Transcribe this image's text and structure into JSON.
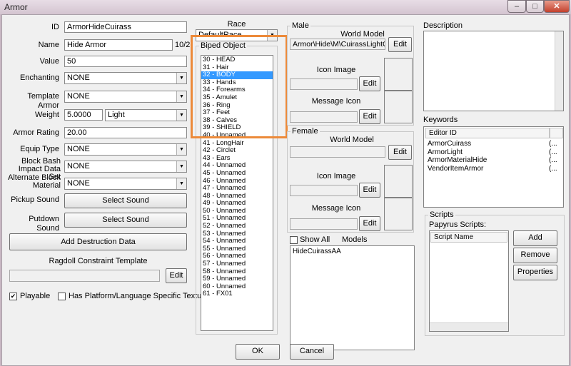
{
  "window": {
    "title": "Armor",
    "minimize": "–",
    "maximize": "□",
    "close": "✕"
  },
  "left": {
    "id_label": "ID",
    "id_value": "ArmorHideCuirass",
    "name_label": "Name",
    "name_value": "Hide Armor",
    "name_counter": "10/2",
    "value_label": "Value",
    "value_value": "50",
    "enchanting_label": "Enchanting",
    "enchanting_value": "NONE",
    "template_label": "Template Armor",
    "template_value": "NONE",
    "weight_label": "Weight",
    "weight_value": "5.0000",
    "weight_class": "Light",
    "armor_rating_label": "Armor Rating",
    "armor_rating_value": "20.00",
    "equip_type_label": "Equip Type",
    "equip_type_value": "NONE",
    "block_bash_label": "Block Bash Impact Data Set",
    "block_bash_value": "NONE",
    "alt_block_label": "Alternate Block Material",
    "alt_block_value": "NONE",
    "pickup_label": "Pickup Sound",
    "pickup_button": "Select Sound",
    "putdown_label": "Putdown Sound",
    "putdown_button": "Select Sound",
    "destruction_button": "Add Destruction Data",
    "ragdoll_label": "Ragdoll Constraint Template",
    "ragdoll_edit": "Edit",
    "playable_label": "Playable",
    "playable_checked": "✔",
    "platform_label": "Has Platform/Language Specific Textures"
  },
  "race": {
    "label": "Race",
    "value": "DefaultRace"
  },
  "biped": {
    "label": "Biped Object",
    "items": [
      "30 - HEAD",
      "31 - Hair",
      "32 - BODY",
      "33 - Hands",
      "34 - Forearms",
      "35 - Amulet",
      "36 - Ring",
      "37 - Feet",
      "38 - Calves",
      "39 - SHIELD",
      "40 - Unnamed",
      "41 - LongHair",
      "42 - Circlet",
      "43 - Ears",
      "44 - Unnamed",
      "45 - Unnamed",
      "46 - Unnamed",
      "47 - Unnamed",
      "48 - Unnamed",
      "49 - Unnamed",
      "50 - Unnamed",
      "51 - Unnamed",
      "52 - Unnamed",
      "53 - Unnamed",
      "54 - Unnamed",
      "55 - Unnamed",
      "56 - Unnamed",
      "57 - Unnamed",
      "58 - Unnamed",
      "59 - Unnamed",
      "60 - Unnamed",
      "61 - FX01"
    ],
    "selected": "32 - BODY"
  },
  "male": {
    "label": "Male",
    "world_model_label": "World Model",
    "world_model_value": "Armor\\Hide\\M\\CuirassLightGND",
    "world_model_edit": "Edit",
    "icon_image_label": "Icon Image",
    "icon_image_edit": "Edit",
    "message_icon_label": "Message Icon",
    "message_icon_edit": "Edit"
  },
  "female": {
    "label": "Female",
    "world_model_label": "World Model",
    "world_model_edit": "Edit",
    "icon_image_label": "Icon Image",
    "icon_image_edit": "Edit",
    "message_icon_label": "Message Icon",
    "message_icon_edit": "Edit"
  },
  "models": {
    "show_all_label": "Show All",
    "label": "Models",
    "items": [
      "HideCuirassAA"
    ]
  },
  "description": {
    "label": "Description"
  },
  "keywords": {
    "label": "Keywords",
    "column": "Editor ID",
    "items": [
      {
        "id": "ArmorCuirass",
        "tail": "(..."
      },
      {
        "id": "ArmorLight",
        "tail": "(..."
      },
      {
        "id": "ArmorMaterialHide",
        "tail": "(..."
      },
      {
        "id": "VendorItemArmor",
        "tail": "(..."
      }
    ]
  },
  "scripts": {
    "label": "Scripts",
    "papyrus_label": "Papyrus Scripts:",
    "column": "Script Name",
    "add": "Add",
    "remove": "Remove",
    "properties": "Properties"
  },
  "footer": {
    "ok": "OK",
    "cancel": "Cancel"
  },
  "colors": {
    "selection": "#3399ff",
    "highlight": "#ec8a3a"
  }
}
